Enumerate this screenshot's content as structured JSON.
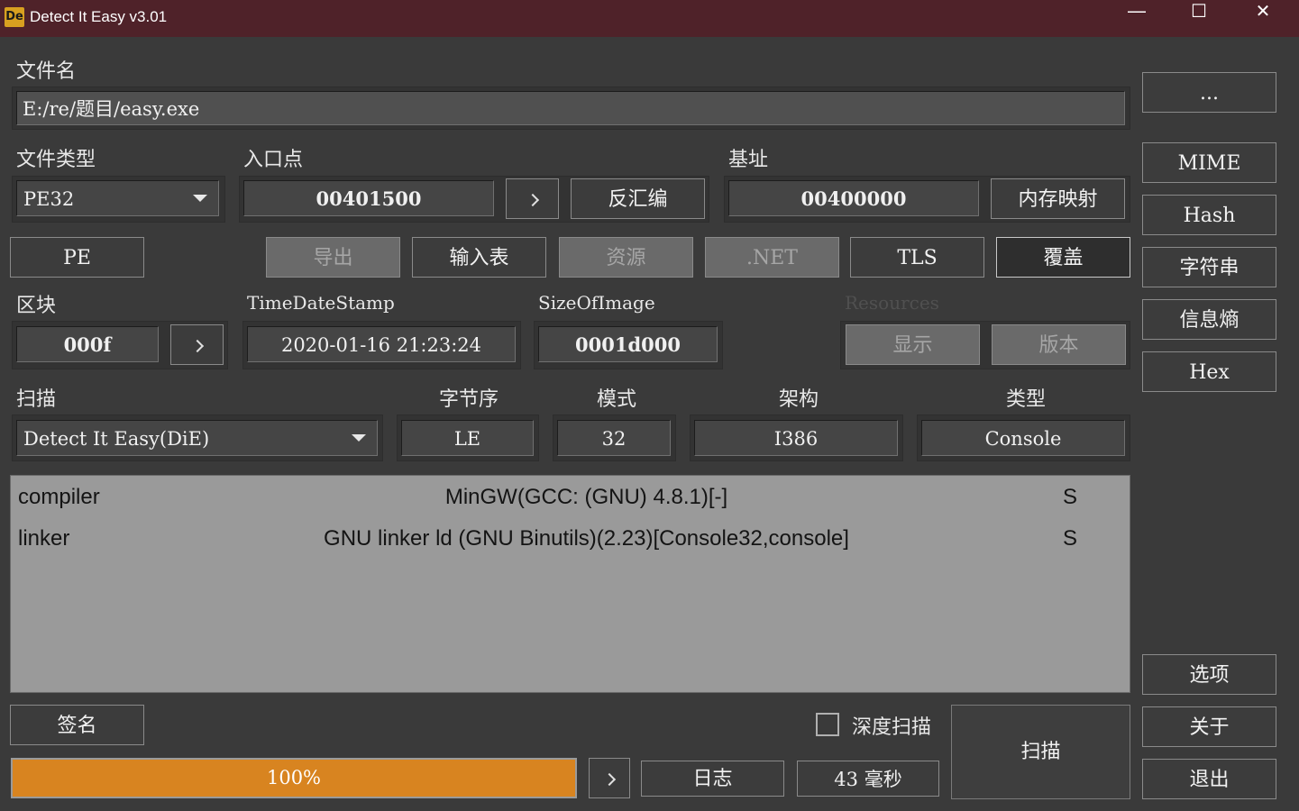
{
  "window": {
    "title": "Detect It Easy v3.01",
    "icon_text": "De"
  },
  "file": {
    "label": "文件名",
    "path": "E:/re/题目/easy.exe",
    "browse_label": "..."
  },
  "filetype": {
    "label": "文件类型",
    "value": "PE32"
  },
  "entry": {
    "label": "入口点",
    "value": "00401500",
    "disasm_label": "反汇编"
  },
  "base": {
    "label": "基址",
    "value": "00400000",
    "memmap_label": "内存映射"
  },
  "pe_label": "PE",
  "tabs": {
    "export": "导出",
    "import": "输入表",
    "resources": "资源",
    "net": ".NET",
    "tls": "TLS",
    "overlay": "覆盖"
  },
  "sections": {
    "label": "区块",
    "value": "000f"
  },
  "timedatestamp": {
    "label": "TimeDateStamp",
    "value": "2020-01-16 21:23:24"
  },
  "sizeofimage": {
    "label": "SizeOfImage",
    "value": "0001d000"
  },
  "resources": {
    "label": "Resources",
    "show": "显示",
    "version": "版本"
  },
  "scan": {
    "label": "扫描",
    "engine": "Detect It Easy(DiE)",
    "endian_label": "字节序",
    "endian": "LE",
    "mode_label": "模式",
    "mode": "32",
    "arch_label": "架构",
    "arch": "I386",
    "type_label": "类型",
    "type": "Console"
  },
  "results": [
    {
      "kind": "compiler",
      "name": "MinGW(GCC: (GNU) 4.8.1)[-]",
      "flag": "S"
    },
    {
      "kind": "linker",
      "name": "GNU linker ld (GNU Binutils)(2.23)[Console32,console]",
      "flag": "S"
    }
  ],
  "side": {
    "mime": "MIME",
    "hash": "Hash",
    "strings": "字符串",
    "entropy": "信息熵",
    "hex": "Hex",
    "options": "选项",
    "about": "关于",
    "exit": "退出"
  },
  "bottom": {
    "signature": "签名",
    "deep_scan": "深度扫描",
    "deep_scan_checked": false,
    "scan_button": "扫描",
    "progress": "100%",
    "progress_value": 1.0,
    "log": "日志",
    "time": "43 毫秒"
  }
}
